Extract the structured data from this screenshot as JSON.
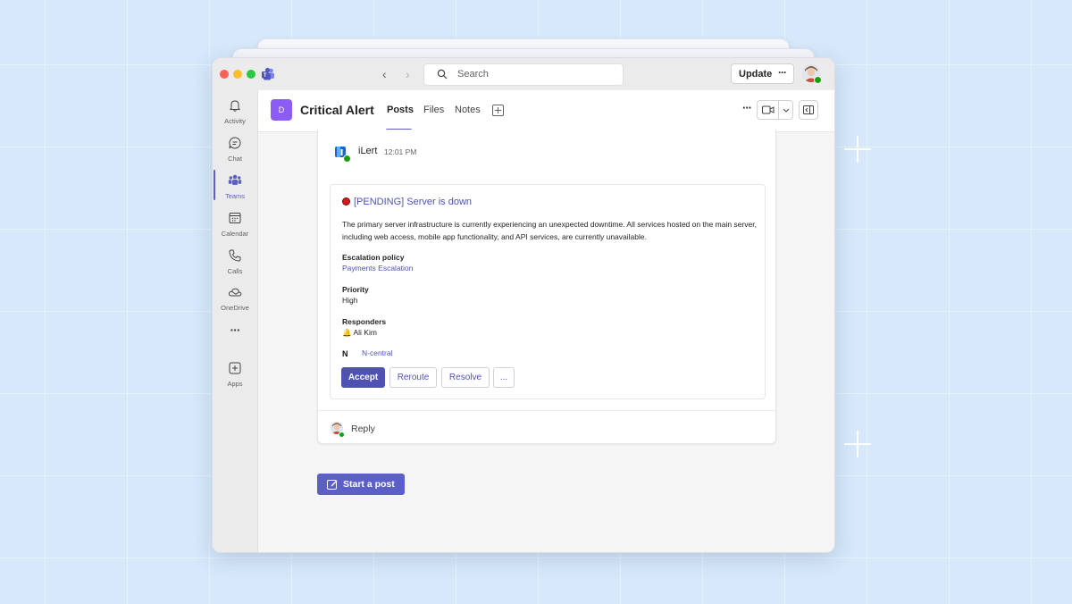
{
  "search": {
    "placeholder": "Search"
  },
  "header_right": {
    "update_label": "Update",
    "more": "···"
  },
  "rail": {
    "items": [
      {
        "label": "Activity",
        "icon": "bell-icon"
      },
      {
        "label": "Chat",
        "icon": "chat-icon"
      },
      {
        "label": "Teams",
        "icon": "teams-icon",
        "active": true
      },
      {
        "label": "Calendar",
        "icon": "calendar-icon"
      },
      {
        "label": "Calls",
        "icon": "phone-icon"
      },
      {
        "label": "OneDrive",
        "icon": "cloud-icon"
      },
      {
        "label": "···",
        "icon": "more-icon"
      },
      {
        "label": "Apps",
        "icon": "add-app-icon"
      }
    ]
  },
  "channel": {
    "avatar_letter": "D",
    "title": "Critical Alert",
    "tabs": [
      {
        "label": "Posts",
        "active": true
      },
      {
        "label": "Files"
      },
      {
        "label": "Notes"
      }
    ],
    "more": "···"
  },
  "message": {
    "sender": "iLert",
    "time": "12:01 PM",
    "card": {
      "title": "[PENDING] Server is down",
      "description": "The primary server infrastructure is currently experiencing an unexpected downtime. All services hosted on the main server, including web access, mobile app functionality, and API services, are currently unavailable.",
      "escalation_label": "Escalation policy",
      "escalation_value": "Payments Escalation",
      "priority_label": "Priority",
      "priority_value": "High",
      "responders_label": "Responders",
      "responders_value": "🔔 Ali Kim",
      "integration_logo": "N",
      "integration_name": "N-central",
      "actions": [
        "Accept",
        "Reroute",
        "Resolve",
        "..."
      ]
    },
    "reply_label": "Reply"
  },
  "compose": {
    "start_post_label": "Start a post"
  },
  "colors": {
    "accent": "#5b5fc7",
    "link": "#4f52b2",
    "alert_red": "#d11a1a",
    "presence_green": "#13a10e"
  }
}
